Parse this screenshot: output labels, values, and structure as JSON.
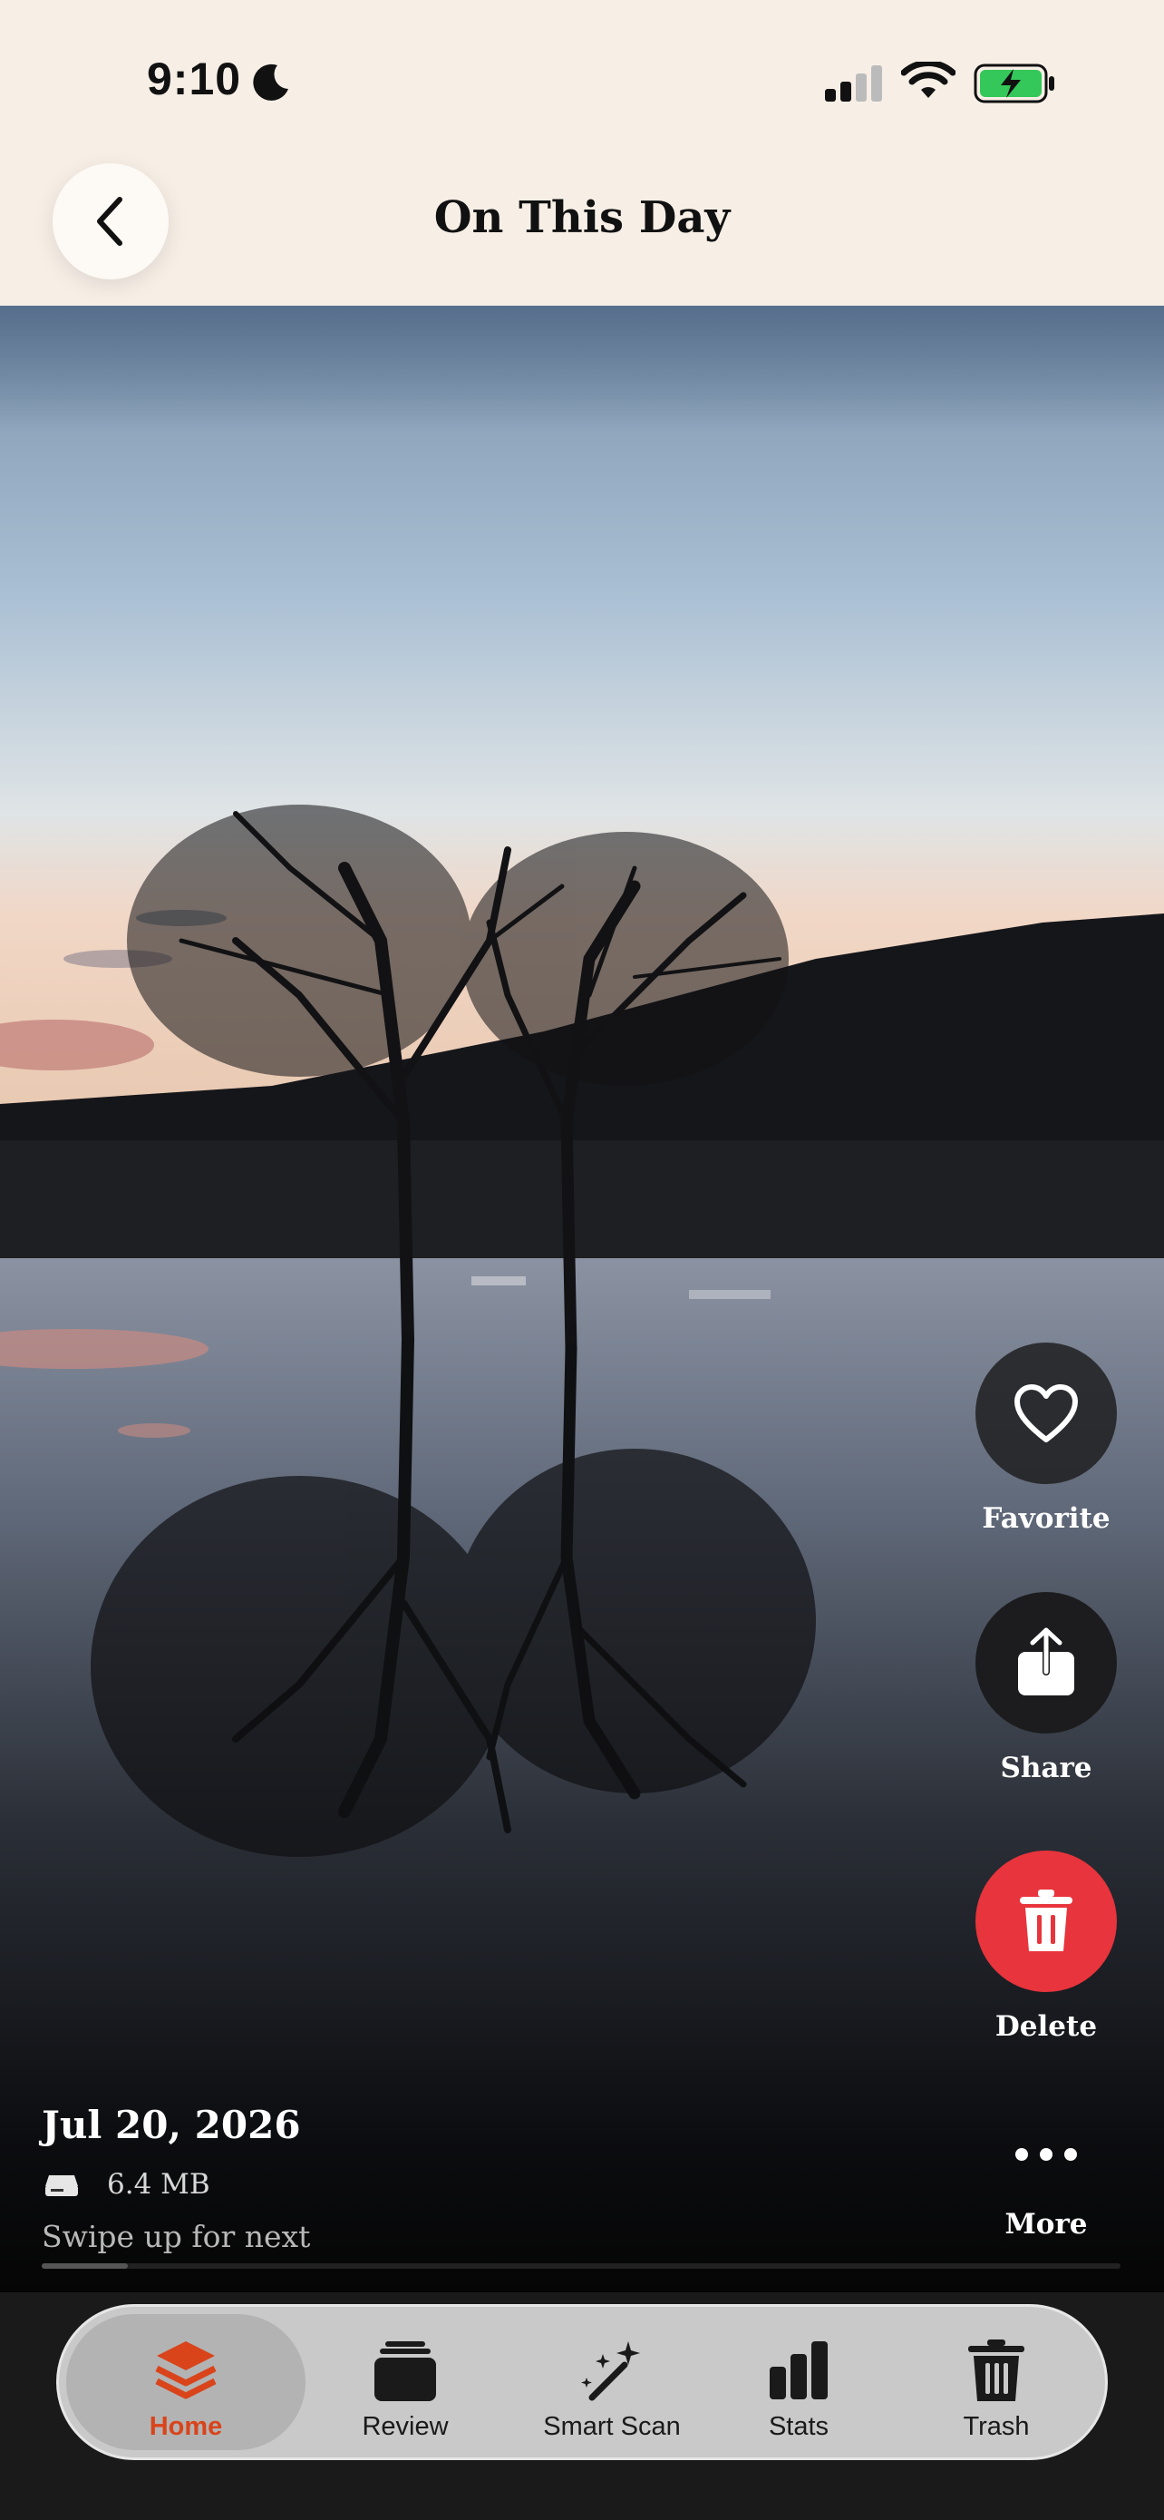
{
  "status_bar": {
    "time": "9:10"
  },
  "header": {
    "title": "On This Day"
  },
  "actions": {
    "favorite": "Favorite",
    "share": "Share",
    "delete": "Delete",
    "more": "More"
  },
  "photo_info": {
    "date": "Jul 20, 2026",
    "size": "6.4 MB",
    "hint": "Swipe up for next"
  },
  "tabs": [
    {
      "label": "Home",
      "icon": "stack-icon",
      "active": true
    },
    {
      "label": "Review",
      "icon": "cards-icon"
    },
    {
      "label": "Smart Scan",
      "icon": "magic-wand-icon"
    },
    {
      "label": "Stats",
      "icon": "bar-chart-icon"
    },
    {
      "label": "Trash",
      "icon": "trash-icon"
    }
  ],
  "colors": {
    "accent": "#d9441b",
    "delete": "#e8343c",
    "header_bg": "#f7efe6"
  }
}
